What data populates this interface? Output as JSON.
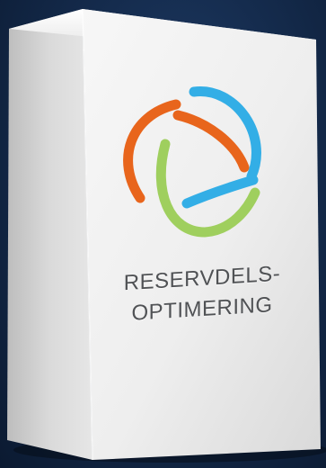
{
  "product": {
    "label_line_1": "RESERVDELS-",
    "label_line_2": "OPTIMERING"
  },
  "logo": {
    "icon": "three-arc-swirl-logo-icon",
    "colors": {
      "orange": "#e8651c",
      "blue": "#33aee6",
      "green": "#9fcf5e"
    }
  },
  "colors": {
    "background": "#152c4e",
    "box_front": "#efefef",
    "box_side": "#d6d6d6",
    "label_text": "#505255"
  }
}
